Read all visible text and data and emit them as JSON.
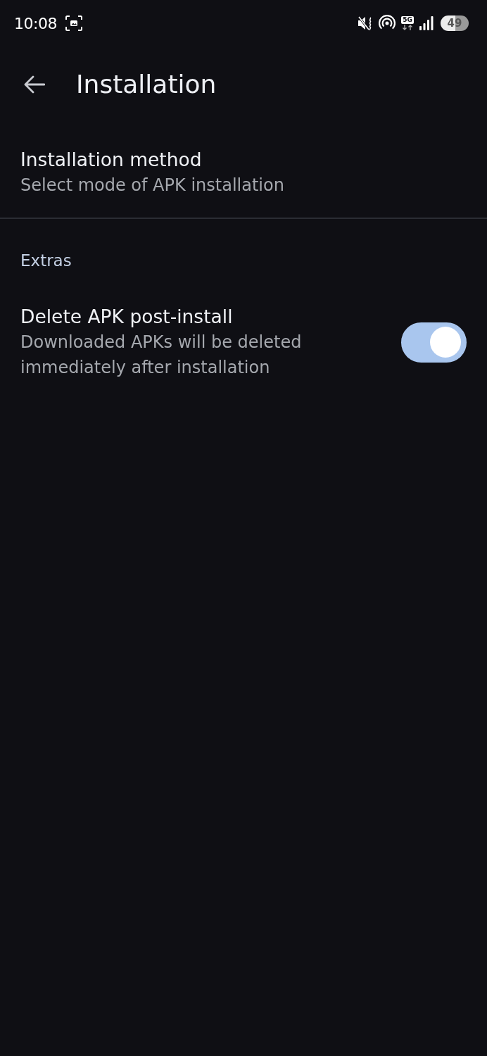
{
  "status_bar": {
    "time": "10:08",
    "network_type": "5G",
    "battery": "49"
  },
  "app_bar": {
    "title": "Installation"
  },
  "sections": [
    {
      "items": [
        {
          "kind": "text",
          "title": "Installation method",
          "summary": "Select mode of APK installation"
        }
      ]
    },
    {
      "header": "Extras",
      "items": [
        {
          "kind": "switch",
          "title": "Delete APK post-install",
          "summary": "Downloaded APKs will be deleted immediately after installation",
          "on": true
        }
      ]
    }
  ]
}
